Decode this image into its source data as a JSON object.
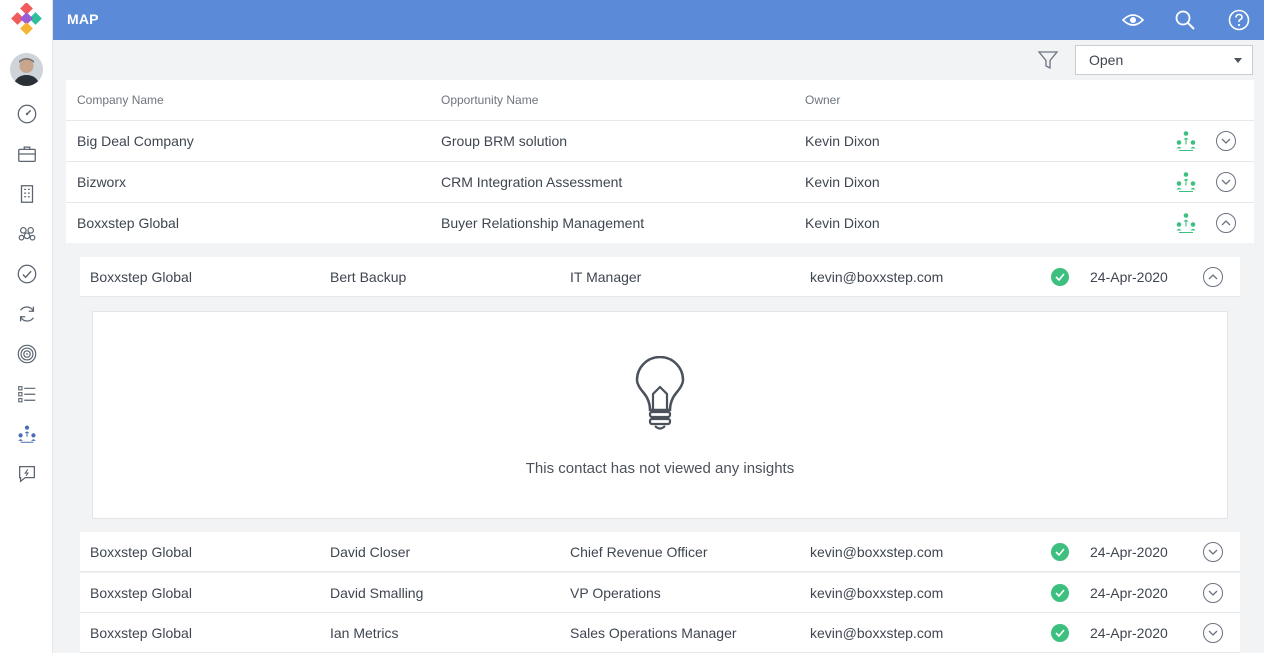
{
  "header": {
    "title": "MAP",
    "icons": [
      "eye-icon",
      "search-icon",
      "help-icon"
    ]
  },
  "sidebar": {
    "items": [
      "dashboard-icon",
      "briefcase-icon",
      "building-icon",
      "people-icon",
      "check-circle-icon",
      "refresh-icon",
      "target-icon",
      "checklist-icon",
      "org-chart-icon",
      "chat-icon"
    ]
  },
  "filter": {
    "selected": "Open"
  },
  "table": {
    "columns": [
      "Company Name",
      "Opportunity Name",
      "Owner"
    ],
    "rows": [
      {
        "company": "Big Deal Company",
        "opportunity": "Group BRM solution",
        "owner": "Kevin Dixon",
        "expanded": false
      },
      {
        "company": "Bizworx",
        "opportunity": "CRM Integration Assessment",
        "owner": "Kevin Dixon",
        "expanded": false
      },
      {
        "company": "Boxxstep Global",
        "opportunity": "Buyer Relationship Management",
        "owner": "Kevin Dixon",
        "expanded": true
      }
    ]
  },
  "contacts": [
    {
      "company": "Boxxstep Global",
      "name": "Bert Backup",
      "title": "IT Manager",
      "email": "kevin@boxxstep.com",
      "date": "24-Apr-2020",
      "expanded": true
    },
    {
      "company": "Boxxstep Global",
      "name": "David Closer",
      "title": "Chief Revenue Officer",
      "email": "kevin@boxxstep.com",
      "date": "24-Apr-2020",
      "expanded": false
    },
    {
      "company": "Boxxstep Global",
      "name": "David Smalling",
      "title": "VP Operations",
      "email": "kevin@boxxstep.com",
      "date": "24-Apr-2020",
      "expanded": false
    },
    {
      "company": "Boxxstep Global",
      "name": "Ian Metrics",
      "title": "Sales Operations Manager",
      "email": "kevin@boxxstep.com",
      "date": "24-Apr-2020",
      "expanded": false
    }
  ],
  "insights": {
    "empty_message": "This contact has not viewed any insights"
  },
  "colors": {
    "topbar": "#5b8ad8",
    "check": "#3dbf7f",
    "org_icon": "#3dbf7f"
  }
}
